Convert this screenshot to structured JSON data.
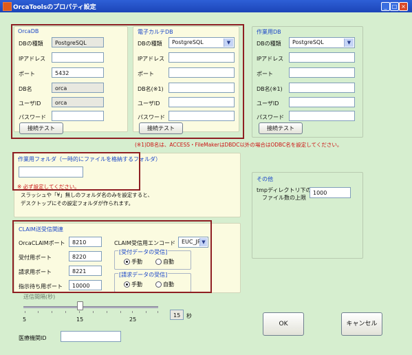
{
  "window": {
    "title": "OrcaToolsのプロパティ設定",
    "minimize": "_",
    "maximize": "□",
    "close": "×"
  },
  "orcadb": {
    "title": "OrcaDB",
    "labels": [
      "DBの種類",
      "IPアドレス",
      "ポート",
      "DB名",
      "ユーザID",
      "パスワード"
    ],
    "values": [
      "PostgreSQL",
      "",
      "5432",
      "orca",
      "orca",
      ""
    ],
    "test_button": "接続テスト"
  },
  "karte": {
    "title": "電子カルテDB",
    "labels": [
      "DBの種類",
      "IPアドレス",
      "ポート",
      "DB名(※1)",
      "ユーザID",
      "パスワード"
    ],
    "dbtype": "PostgreSQL",
    "test_button": "接続テスト"
  },
  "workdb": {
    "title": "作業用DB",
    "labels": [
      "DBの種類",
      "IPアドレス",
      "ポート",
      "DB名(※1)",
      "ユーザID",
      "パスワード"
    ],
    "dbtype": "PostgreSQL",
    "test_button": "接続テスト"
  },
  "note_db": "(※1)DB名は、ACCESS・FileMakerはDBDC以外の場合はODBC名を設定してください。",
  "folder": {
    "title": "作業用フォルダ（一時的にファイルを格納するフォルダ）",
    "value": "",
    "required": "※ 必ず設定してください。",
    "desc1": "スラッシュや「¥」無しのフォルダ名のみを設定すると、",
    "desc2": "デスクトップにその設定フォルダが作られます。"
  },
  "other": {
    "title": "その他",
    "label1": "tmpディレクトリ下の",
    "label2": "ファイル数の上限",
    "value": "1000"
  },
  "claim": {
    "title": "CLAIM送受信関連",
    "labels": [
      "OrcaCLAIMポート",
      "受付用ポート",
      "請求用ポート",
      "指示待ち用ポート"
    ],
    "values": [
      "8210",
      "8220",
      "8221",
      "10000"
    ],
    "encode_label": "CLAIM受信用エンコード",
    "encode_value": "EUC_JP",
    "recv1_title": "[受付データの受信]",
    "recv2_title": "[請求データの受信]",
    "manual": "手動",
    "auto": "自動"
  },
  "interval": {
    "title": "送信間隔(秒)",
    "tick_labels": [
      "5",
      "15",
      "25"
    ],
    "value": "15",
    "unit": "秒"
  },
  "hospital_label": "医療機関ID",
  "hospital_value": "",
  "ok": "OK",
  "cancel": "キャンセル"
}
